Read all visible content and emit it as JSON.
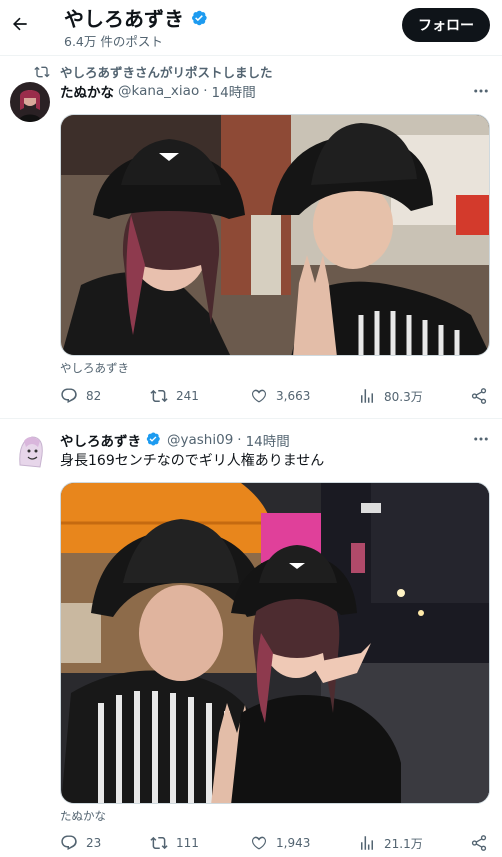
{
  "header": {
    "name": "やしろあずき",
    "post_count": "6.4万 件のポスト",
    "follow_label": "フォロー"
  },
  "tweet1": {
    "repost_text": "やしろあずきさんがリポストしました",
    "author_name": "たぬかな",
    "handle": "@kana_xiao",
    "time": "14時間",
    "tagged": "やしろあずき",
    "stats": {
      "replies": "82",
      "reposts": "241",
      "likes": "3,663",
      "views": "80.3万"
    }
  },
  "tweet2": {
    "author_name": "やしろあずき",
    "handle": "@yashi09",
    "time": "14時間",
    "text": "身長169センチなのでギリ人権ありません",
    "tagged": "たぬかな",
    "stats": {
      "replies": "23",
      "reposts": "111",
      "likes": "1,943",
      "views": "21.1万"
    }
  },
  "sep": "·",
  "colors": {
    "accent": "#1d9bf0",
    "text": "#0f1419",
    "muted": "#536471"
  },
  "icons": [
    "back-arrow-icon",
    "verified-badge-icon",
    "repost-icon",
    "more-icon",
    "reply-icon",
    "like-icon",
    "views-icon",
    "share-icon"
  ]
}
